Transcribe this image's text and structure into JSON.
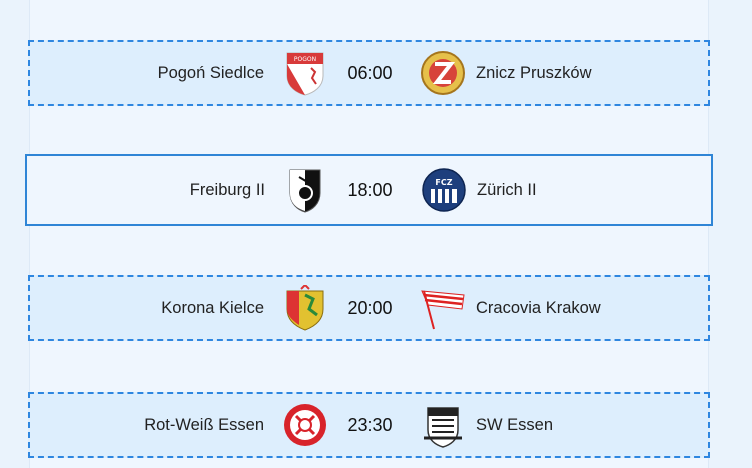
{
  "matches": [
    {
      "home": "Pogoń Siedlce",
      "time": "06:00",
      "away": "Znicz Pruszków",
      "home_logo": "pogon-siedlce-crest",
      "away_logo": "znicz-pruszkow-crest",
      "state": "dashed"
    },
    {
      "home": "Freiburg II",
      "time": "18:00",
      "away": "Zürich II",
      "home_logo": "freiburg-crest",
      "away_logo": "fc-zurich-crest",
      "state": "selected",
      "away_logo_text": "FCZ"
    },
    {
      "home": "Korona Kielce",
      "time": "20:00",
      "away": "Cracovia Krakow",
      "home_logo": "korona-kielce-crest",
      "away_logo": "cracovia-crest",
      "state": "dashed"
    },
    {
      "home": "Rot-Weiß Essen",
      "time": "23:30",
      "away": "SW Essen",
      "home_logo": "rot-weiss-essen-crest",
      "away_logo": "sw-essen-crest",
      "state": "dashed"
    }
  ],
  "colors": {
    "highlight_border": "#2e86e0",
    "row_background": "#ddeefd",
    "panel_background": "#eff6fe"
  }
}
